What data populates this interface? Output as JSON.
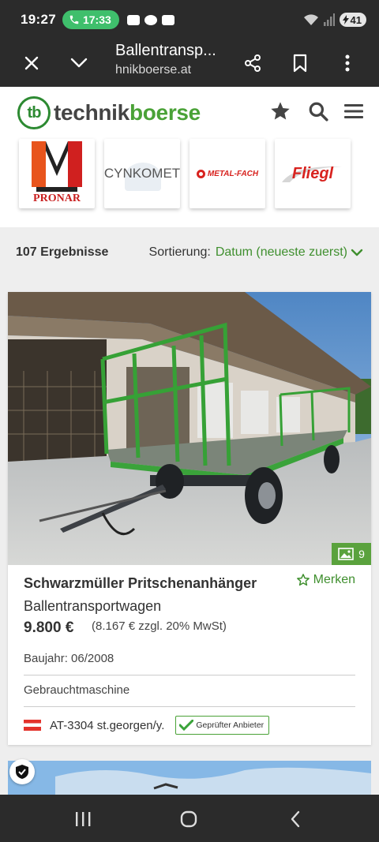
{
  "status_bar": {
    "time": "19:27",
    "call_time": "17:33",
    "battery": "41"
  },
  "browser": {
    "page_title": "Ballentransp...",
    "url": "hnikboerse.at",
    "close_icon": "close-icon",
    "menu_icon": "chevron-down-icon",
    "share_icon": "share-icon",
    "bookmark_icon": "bookmark-icon",
    "more_icon": "more-vert-icon"
  },
  "site": {
    "logo_mark": "tb",
    "logo_part1": "technik",
    "logo_part2": "boerse",
    "brand_color": "#4aa237",
    "brands": [
      {
        "name": "PRONAR"
      },
      {
        "name": "CYNKOMET"
      },
      {
        "name": "METAL-FACH"
      },
      {
        "name": "Fliegl"
      }
    ]
  },
  "results": {
    "count": "107 Ergebnisse",
    "sort_label": "Sortierung:",
    "sort_value": "Datum (neueste zuerst)"
  },
  "listing": {
    "image_count": "9",
    "title": "Schwarzmüller Pritschenanhänger",
    "merken": "Merken",
    "subtitle": "Ballentransportwagen",
    "price": "9.800 €",
    "vat": "(8.167 € zzgl. 20% MwSt)",
    "year": "Baujahr: 06/2008",
    "condition": "Gebrauchtmaschine",
    "location": "AT-3304 st.georgen/y.",
    "badge": "Geprüfter Anbieter"
  }
}
